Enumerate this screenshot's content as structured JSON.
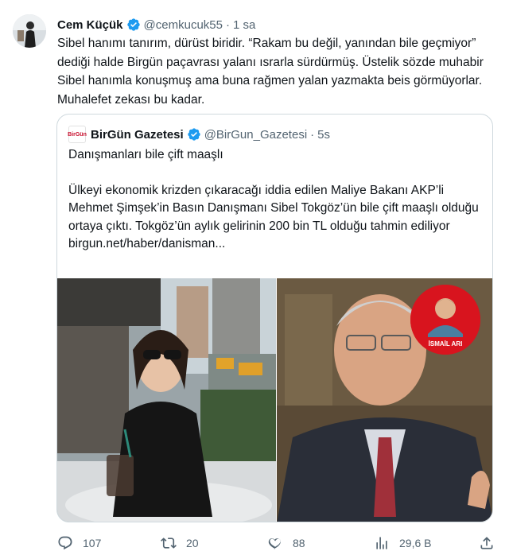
{
  "tweet": {
    "author_name": "Cem Küçük",
    "handle": "@cemkucuk55",
    "separator": "·",
    "time": "1 sa",
    "text": "Sibel hanımı tanırım, dürüst biridir. “Rakam bu değil, yanından bile geçmiyor” dediği halde Birgün paçavrası yalanı ısrarla sürdürmüş. Üstelik sözde muhabir Sibel hanımla konuşmuş ama buna rağmen yalan yazmakta beis görmüyorlar. Muhalefet zekası bu kadar."
  },
  "quote": {
    "logo_text": "BirGün",
    "author_name": "BirGün Gazetesi",
    "handle": "@BirGun_Gazetesi",
    "separator": "·",
    "time": "5s",
    "headline": "Danışmanları bile çift maaşlı",
    "body": "Ülkeyi ekonomik krizden çıkaracağı iddia edilen Maliye Bakanı AKP’li Mehmet Şimşek’in Basın Danışmanı Sibel Tokgöz’ün bile çift maaşlı olduğu ortaya çıktı. Tokgöz’ün aylık gelirinin 200 bin TL olduğu tahmin ediliyor",
    "link": "birgun.net/haber/danisman...",
    "badge_label": "İSMAİL ARI"
  },
  "actions": {
    "replies": "107",
    "retweets": "20",
    "likes": "88",
    "views": "29,6 B"
  },
  "colors": {
    "verified": "#1d9bf0",
    "secondary_text": "#536471",
    "border": "#cfd9de",
    "badge_red": "#d8141e"
  }
}
